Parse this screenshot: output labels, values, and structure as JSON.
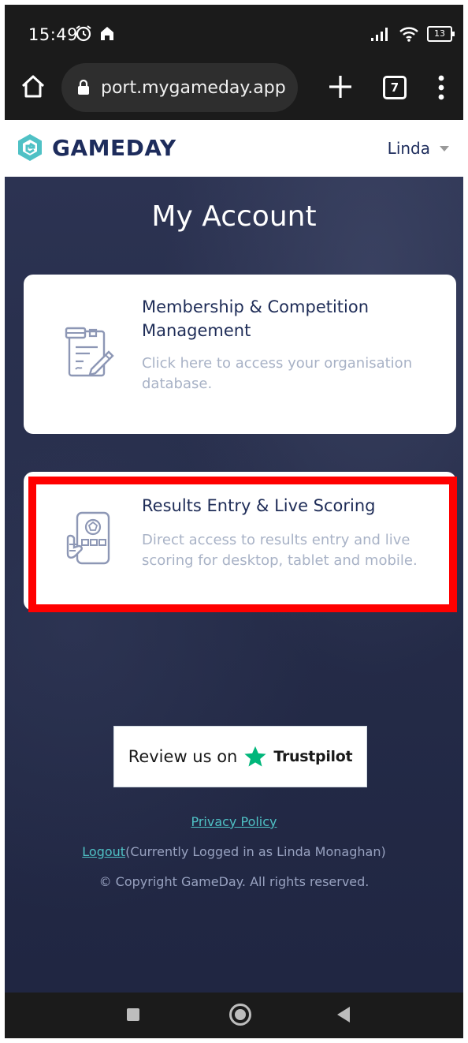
{
  "status_bar": {
    "time": "15:49",
    "battery": "13"
  },
  "browser": {
    "url": "port.mygameday.app",
    "tab_count": "7"
  },
  "header": {
    "logo_text": "GAMEDAY",
    "user_name": "Linda"
  },
  "main": {
    "title": "My Account",
    "cards": [
      {
        "title": "Membership & Competition Management",
        "description": "Click here to access your organisation database."
      },
      {
        "title": "Results Entry & Live Scoring",
        "description": "Direct access to results entry and live scoring for desktop, tablet and mobile."
      }
    ],
    "trustpilot": {
      "prefix": "Review us on",
      "brand": "Trustpilot"
    }
  },
  "footer": {
    "privacy": "Privacy Policy",
    "logout": "Logout",
    "logged_in_as": "(Currently Logged in as Linda Monaghan)",
    "copyright": "© Copyright GameDay. All rights reserved."
  },
  "colors": {
    "brand_navy": "#1d2c5c",
    "brand_teal": "#4fc1c5",
    "highlight": "#ff0000",
    "trustpilot_green": "#00b67a"
  }
}
